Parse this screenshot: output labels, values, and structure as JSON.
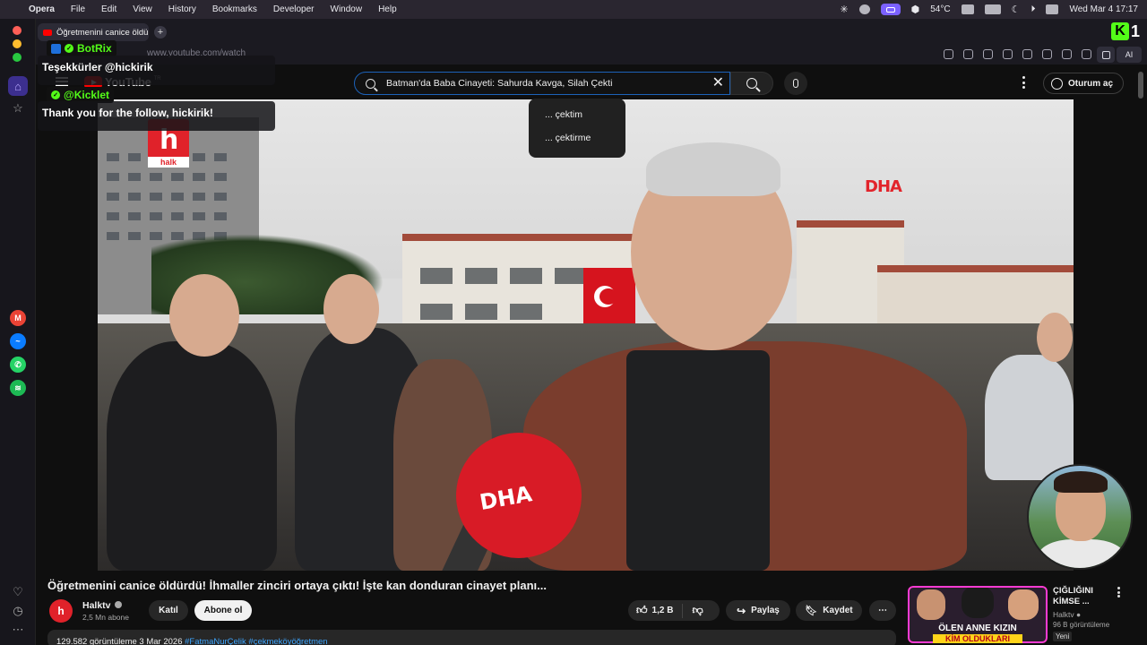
{
  "menubar": {
    "apple": "",
    "app": "Opera",
    "items": [
      "File",
      "Edit",
      "View",
      "History",
      "Bookmarks",
      "Developer",
      "Window",
      "Help"
    ],
    "temperature": "54°C",
    "datetime": "Wed Mar 4  17:17"
  },
  "browser": {
    "tab_title": "Öğretmenini canice öldü",
    "url": "www.youtube.com/watch",
    "ai_label": "AI",
    "kick_logo": "K",
    "kick_one": "1"
  },
  "youtube": {
    "logo": "YouTube",
    "logo_region": "TR",
    "search_value": "Batman'da Baba Cinayeti: Sahurda Kavga, Silah Çekti",
    "signin": "Oturum aç",
    "suggestions": [
      "... çektim",
      "... çektirme"
    ]
  },
  "video": {
    "watermark": "DHA",
    "channel_logo_letter": "h",
    "channel_logo_word": "halk",
    "mic_label": "DHA"
  },
  "chat": [
    {
      "user": "BotRix",
      "message": "Teşekkürler @hickirik"
    },
    {
      "user": "@Kicklet",
      "message": "Thank you for the follow, hickirik!"
    }
  ],
  "details": {
    "title": "Öğretmenini canice öldürdü! İhmaller zinciri ortaya çıktı! İşte kan donduran cinayet planı...",
    "channel": "Halktv",
    "channel_avatar": "h",
    "subscribers": "2,5 Mn abone",
    "join": "Katıl",
    "subscribe": "Abone ol",
    "likes": "1,2 B",
    "share": "Paylaş",
    "save": "Kaydet",
    "description": "129.582 görüntüleme  3 Mar 2026",
    "description_tags": "#FatmaNurÇelik #çekmeköyöğretmen"
  },
  "recommended": {
    "thumb_caption_1": "ÖLEN ANNE KIZIN",
    "thumb_caption_2": "KİM OLDUKLARI",
    "title": "ÇIĞLIĞINI KİMSE ...",
    "channel": "Halktv",
    "views": "96 B görüntüleme",
    "badge": "Yeni"
  },
  "colors": {
    "accent": "#53fc18",
    "youtube_red": "#ff0000",
    "link": "#3ea6ff"
  }
}
